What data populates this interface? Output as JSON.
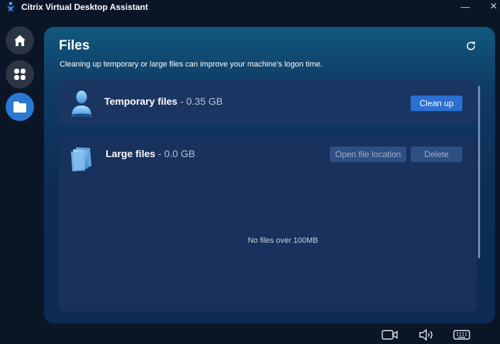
{
  "window": {
    "title": "Citrix Virtual Desktop Assistant",
    "minimize_glyph": "—",
    "close_glyph": "✕"
  },
  "sidebar": {
    "items": [
      {
        "name": "home",
        "icon": "home-icon",
        "active": false
      },
      {
        "name": "apps",
        "icon": "apps-grid-icon",
        "active": false
      },
      {
        "name": "files",
        "icon": "folder-icon",
        "active": true
      }
    ]
  },
  "panel": {
    "title": "Files",
    "subtitle": "Cleaning up temporary or large files can improve your machine's logon time."
  },
  "temporary_files": {
    "label": "Temporary files",
    "size": " - 0.35 GB",
    "cleanup_label": "Clean up"
  },
  "large_files": {
    "label": "Large files",
    "size": " - 0.0 GB",
    "open_location_label": "Open file location",
    "delete_label": "Delete",
    "empty_message": "No files over 100MB"
  },
  "footer": {
    "icons": [
      "camera-icon",
      "speaker-icon",
      "keyboard-icon"
    ]
  },
  "colors": {
    "background": "#0a1526",
    "accent": "#2a78d2",
    "panel_top": "#11577e",
    "card": "#1b3563"
  }
}
